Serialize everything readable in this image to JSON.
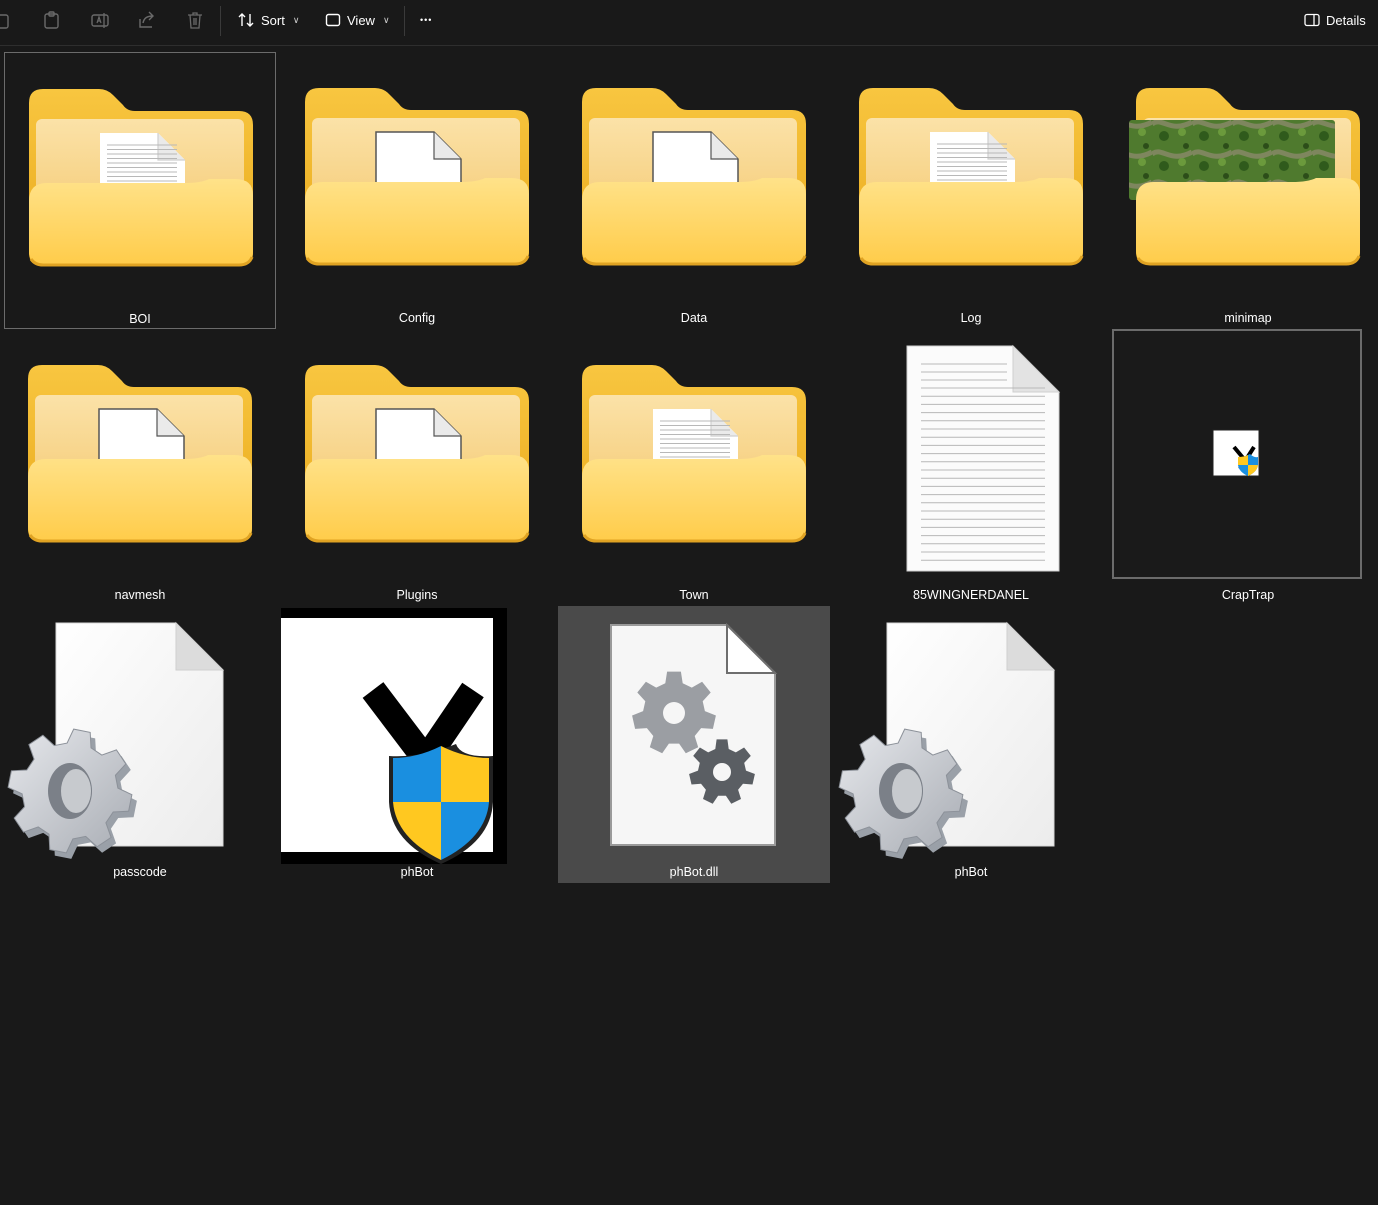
{
  "toolbar": {
    "sort_label": "Sort",
    "view_label": "View",
    "details_label": "Details",
    "more_label": "•••"
  },
  "items": [
    {
      "name": "BOI",
      "type": "folder",
      "preview": "lined-document",
      "state": "focused"
    },
    {
      "name": "Config",
      "type": "folder",
      "preview": "blank-document",
      "state": "normal"
    },
    {
      "name": "Data",
      "type": "folder",
      "preview": "blank-document",
      "state": "normal"
    },
    {
      "name": "Log",
      "type": "folder",
      "preview": "lined-document",
      "state": "normal"
    },
    {
      "name": "minimap",
      "type": "folder",
      "preview": "map-image",
      "state": "normal"
    },
    {
      "name": "navmesh",
      "type": "folder",
      "preview": "blank-document",
      "state": "normal"
    },
    {
      "name": "Plugins",
      "type": "folder",
      "preview": "blank-document",
      "state": "normal"
    },
    {
      "name": "Town",
      "type": "folder",
      "preview": "lined-document",
      "state": "normal"
    },
    {
      "name": "85WINGNERDANEL",
      "type": "text-file",
      "preview": "lined-document",
      "state": "normal"
    },
    {
      "name": "CrapTrap",
      "type": "shortcut-image",
      "preview": "phbot-small-icon",
      "state": "framed"
    },
    {
      "name": "passcode",
      "type": "system-file",
      "preview": "gear-document",
      "state": "normal"
    },
    {
      "name": "phBot",
      "type": "application",
      "preview": "phbot-uac-icon",
      "state": "normal"
    },
    {
      "name": "phBot.dll",
      "type": "dll",
      "preview": "dll-gears-document",
      "state": "selected"
    },
    {
      "name": "phBot",
      "type": "system-file",
      "preview": "gear-document",
      "state": "normal"
    }
  ],
  "colors": {
    "background": "#191919",
    "folder_back": "#f7c23a",
    "folder_front": "#ffd867",
    "selected_bg": "#4a4a4a"
  }
}
